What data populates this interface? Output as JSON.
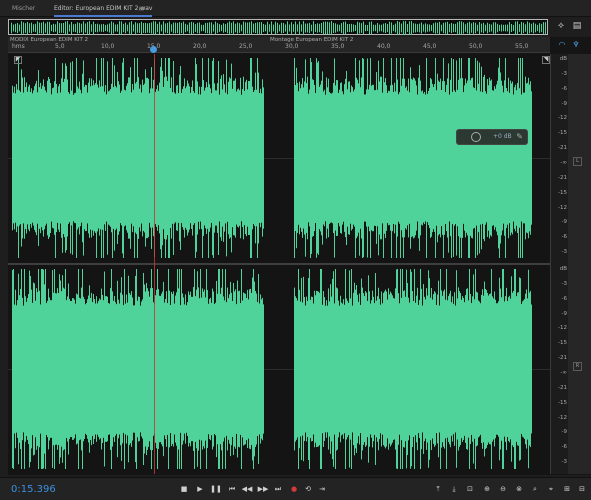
{
  "tabs": {
    "mixer": "Mischer",
    "editor": "Editor: European EDIM KIT 2.wav",
    "editor_menu": "≡"
  },
  "ruler": {
    "start": "hms",
    "ticks": [
      "5,0",
      "10,0",
      "15,0",
      "20,0",
      "25,0",
      "30,0",
      "35,0",
      "40,0",
      "45,0",
      "50,0",
      "55,0"
    ],
    "clip_left_label": "MODIX European EDIM KIT 2",
    "clip_right_label": "Montage European EDIM KIT 2"
  },
  "db_scale": {
    "unit": "dB",
    "top_channel": [
      "dB",
      "-3",
      "-6",
      "-9",
      "-12",
      "-15",
      "-21",
      "-∞",
      "-21",
      "-15",
      "-12",
      "-9",
      "-6",
      "-3"
    ],
    "bottom_channel": [
      "dB",
      "-3",
      "-6",
      "-9",
      "-12",
      "-15",
      "-21",
      "-∞",
      "-21",
      "-15",
      "-12",
      "-9",
      "-6",
      "-3"
    ]
  },
  "channels": {
    "left": "L",
    "right": "R"
  },
  "hud": {
    "value": "+0 dB"
  },
  "status": {
    "time": "0:15.396"
  },
  "colors": {
    "waveform": "#4fd39a",
    "accent": "#3d8fe0",
    "playhead": "#c03b3b"
  },
  "transport": [
    "stop",
    "play",
    "pause",
    "rewind",
    "fast-forward",
    "skip-to-end",
    "record",
    "loop",
    "skip-selection"
  ],
  "zoom_tools": [
    "zoom-in-amplitude",
    "zoom-out-amplitude",
    "zoom-to-selection",
    "zoom-in",
    "zoom-out",
    "zoom-full",
    "zoom-selection",
    "zoom-reset",
    "zoom-in-time"
  ]
}
